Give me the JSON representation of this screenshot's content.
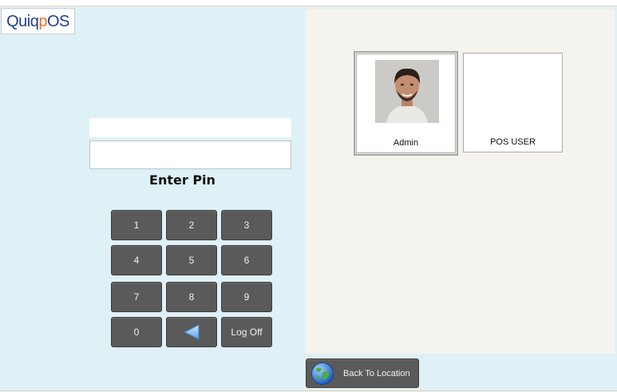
{
  "logo": {
    "part1": "Quiq",
    "part2": "p",
    "part3": "OS"
  },
  "pin": {
    "display_value": "",
    "input_value": "",
    "label": "Enter Pin"
  },
  "keypad": {
    "k1": "1",
    "k2": "2",
    "k3": "3",
    "k4": "4",
    "k5": "5",
    "k6": "6",
    "k7": "7",
    "k8": "8",
    "k9": "9",
    "k0": "0",
    "backspace_icon": "left-arrow-icon",
    "logoff": "Log Off"
  },
  "users": [
    {
      "name": "Admin",
      "selected": true,
      "avatar": "user-photo"
    },
    {
      "name": "POS USER",
      "selected": false,
      "avatar": "none"
    }
  ],
  "footer": {
    "back_label": "Back To Location",
    "back_icon": "globe-icon"
  },
  "colors": {
    "left_bg": "#dff0f7",
    "right_bg": "#f4f3ee",
    "button_bg": "#5a5a5a",
    "logo_blue": "#1f3f91",
    "logo_orange": "#e8711f"
  }
}
